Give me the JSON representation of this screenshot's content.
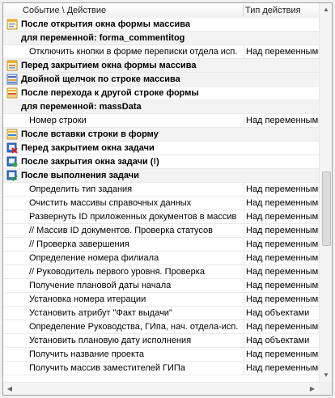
{
  "header": {
    "col1": "Событие \\ Действие",
    "col2": "Тип действия"
  },
  "rows": [
    {
      "kind": "evt",
      "icon": "form-open-icon",
      "text": "После открытия окна формы массива",
      "type": "",
      "shaded": false
    },
    {
      "kind": "evt",
      "icon": "",
      "text": "для переменной: forma_commentitog",
      "type": "",
      "shaded": true
    },
    {
      "kind": "act",
      "icon": "",
      "text": "Отключить кнопки в форме переписки отдела исп.",
      "type": "Над переменными"
    },
    {
      "kind": "evt",
      "icon": "form-close-icon",
      "text": "Перед закрытием окна формы массива",
      "type": "",
      "shaded": true
    },
    {
      "kind": "evt",
      "icon": "double-click-icon",
      "text": "Двойной щелчок по строке массива",
      "type": "",
      "shaded": true
    },
    {
      "kind": "evt",
      "icon": "row-move-icon",
      "text": "После перехода к другой строке формы",
      "type": "",
      "shaded": false
    },
    {
      "kind": "evt",
      "icon": "",
      "text": "для переменной: massData",
      "type": "",
      "shaded": true
    },
    {
      "kind": "act",
      "icon": "",
      "text": "Номер строки",
      "type": "Над переменными"
    },
    {
      "kind": "evt",
      "icon": "row-insert-icon",
      "text": "После вставки строки в форму",
      "type": "",
      "shaded": true
    },
    {
      "kind": "evt",
      "icon": "task-close-icon",
      "text": "Перед закрытием окна задачи",
      "type": "",
      "shaded": false
    },
    {
      "kind": "evt",
      "icon": "task-closed-icon",
      "text": "После закрытия окна задачи (!)",
      "type": "",
      "shaded": false
    },
    {
      "kind": "evt",
      "icon": "task-done-icon",
      "text": "После выполнения задачи",
      "type": "",
      "shaded": true
    },
    {
      "kind": "act",
      "icon": "",
      "text": "Определить тип задания",
      "type": "Над переменными"
    },
    {
      "kind": "act",
      "icon": "",
      "text": "Очистить  массивы справочных данных",
      "type": "Над переменными"
    },
    {
      "kind": "act",
      "icon": "",
      "text": "Развернуть ID приложенных документов в массив",
      "type": "Над переменными"
    },
    {
      "kind": "act",
      "icon": "",
      "text": "// Массив ID документов. Проверка статусов",
      "type": "Над переменными"
    },
    {
      "kind": "act",
      "icon": "",
      "text": "// Проверка завершения",
      "type": "Над переменными"
    },
    {
      "kind": "act",
      "icon": "",
      "text": "Определение номера филиала",
      "type": "Над переменными"
    },
    {
      "kind": "act",
      "icon": "",
      "text": "// Руководитель первого уровня. Проверка",
      "type": "Над переменными"
    },
    {
      "kind": "act",
      "icon": "",
      "text": "Получение плановой даты начала",
      "type": "Над переменными"
    },
    {
      "kind": "act",
      "icon": "",
      "text": "Установка номера итерации",
      "type": "Над переменными"
    },
    {
      "kind": "act",
      "icon": "",
      "text": "Установить атрибут \"Факт выдачи\"",
      "type": "Над объектами"
    },
    {
      "kind": "act",
      "icon": "",
      "text": " Определение Руководства, ГИпа, нач. отдела-исп.",
      "type": "Над переменными"
    },
    {
      "kind": "act",
      "icon": "",
      "text": "Установить  плановую дату исполнения",
      "type": "Над объектами"
    },
    {
      "kind": "act",
      "icon": "",
      "text": "Получить название проекта",
      "type": "Над переменными"
    },
    {
      "kind": "act",
      "icon": "",
      "text": "Получить массив заместителей ГИПа",
      "type": "Над переменными"
    }
  ]
}
